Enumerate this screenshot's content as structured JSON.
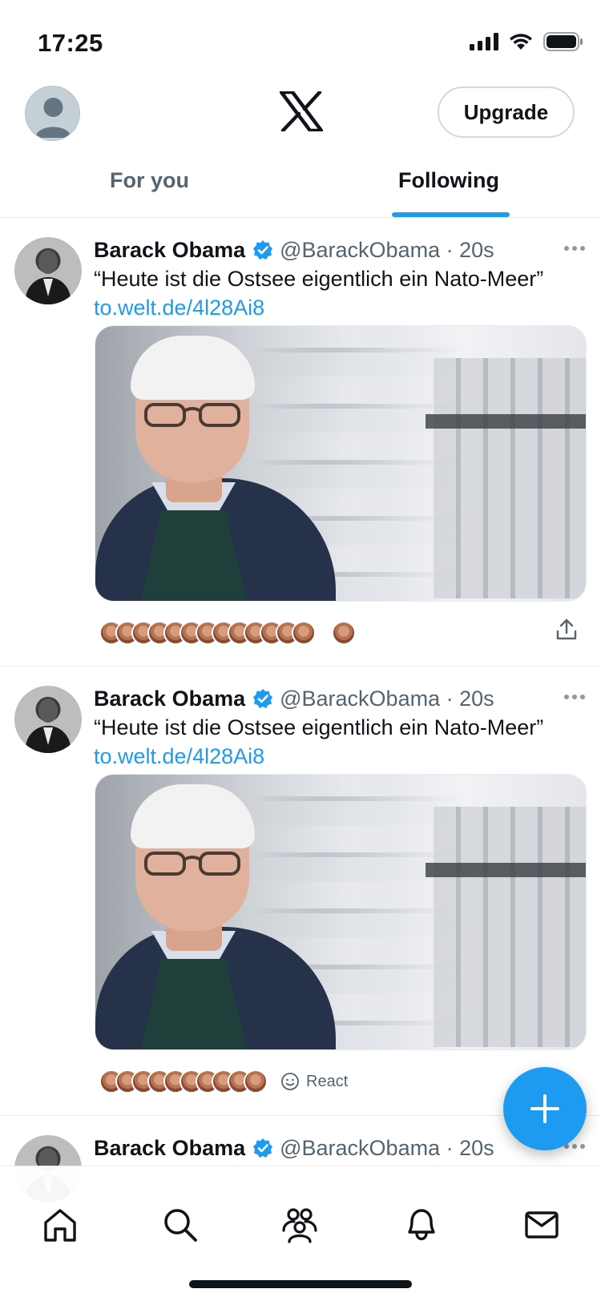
{
  "status_bar": {
    "time": "17:25"
  },
  "header": {
    "upgrade_label": "Upgrade"
  },
  "tabs": [
    {
      "label": "For you",
      "active": false
    },
    {
      "label": "Following",
      "active": true
    }
  ],
  "posts": [
    {
      "author": "Barack Obama",
      "handle": "@BarackObama · 20s",
      "text": "“Heute ist die Ostsee eigentlich ein Nato-Meer”",
      "link": "to.welt.de/4l28Ai8",
      "reaction_faces": 14,
      "react_label": "",
      "has_share": true
    },
    {
      "author": "Barack Obama",
      "handle": "@BarackObama · 20s",
      "text": "“Heute ist die Ostsee eigentlich ein Nato-Meer”",
      "link": "to.welt.de/4l28Ai8",
      "reaction_faces": 10,
      "react_label": "React",
      "has_share": false
    },
    {
      "author": "Barack Obama",
      "handle": "@BarackObama · 20s"
    }
  ],
  "colors": {
    "accent": "#1d9bf0",
    "text_primary": "#0f1419",
    "text_secondary": "#536471",
    "divider": "#e6ecf0"
  },
  "icons": {
    "status": [
      "cellular-signal-icon",
      "wifi-icon",
      "battery-icon"
    ],
    "bottom_nav": [
      "home-icon",
      "search-icon",
      "communities-icon",
      "notifications-icon",
      "messages-icon"
    ],
    "fab": "plus-icon"
  }
}
